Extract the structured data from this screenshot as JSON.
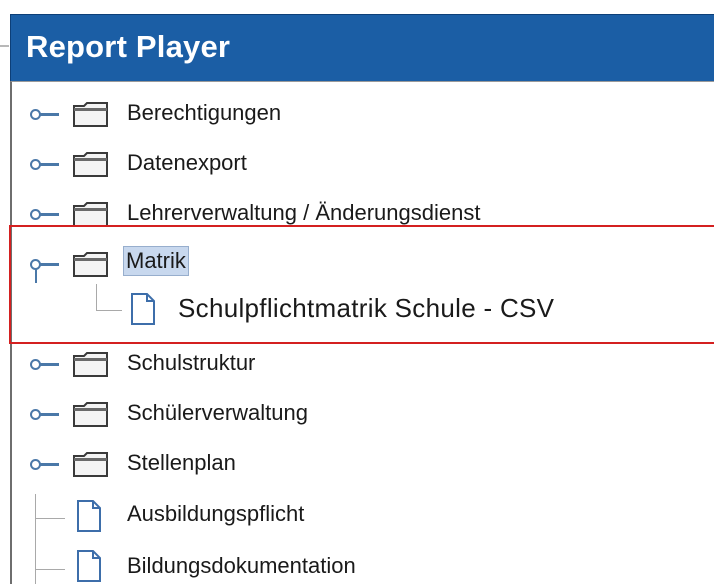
{
  "window": {
    "title": "Report Player"
  },
  "tree": {
    "items": [
      {
        "label": "Berechtigungen",
        "type": "folder"
      },
      {
        "label": "Datenexport",
        "type": "folder"
      },
      {
        "label": "Lehrerverwaltung / Änderungsdienst",
        "type": "folder"
      },
      {
        "label": "Matrik",
        "type": "folder",
        "expanded": true,
        "selected": true,
        "children": [
          {
            "label": "Schulpflichtmatrik Schule - CSV",
            "type": "report"
          }
        ]
      },
      {
        "label": "Schulstruktur",
        "type": "folder"
      },
      {
        "label": "Schülerverwaltung",
        "type": "folder"
      },
      {
        "label": "Stellenplan",
        "type": "folder"
      },
      {
        "label": "Ausbildungspflicht",
        "type": "report"
      },
      {
        "label": "Bildungsdokumentation",
        "type": "report"
      }
    ]
  },
  "colors": {
    "title_bar": "#1b5ea5",
    "selection": "#c8d8ee",
    "highlight_frame": "#d42020",
    "handle": "#4a78a8"
  }
}
